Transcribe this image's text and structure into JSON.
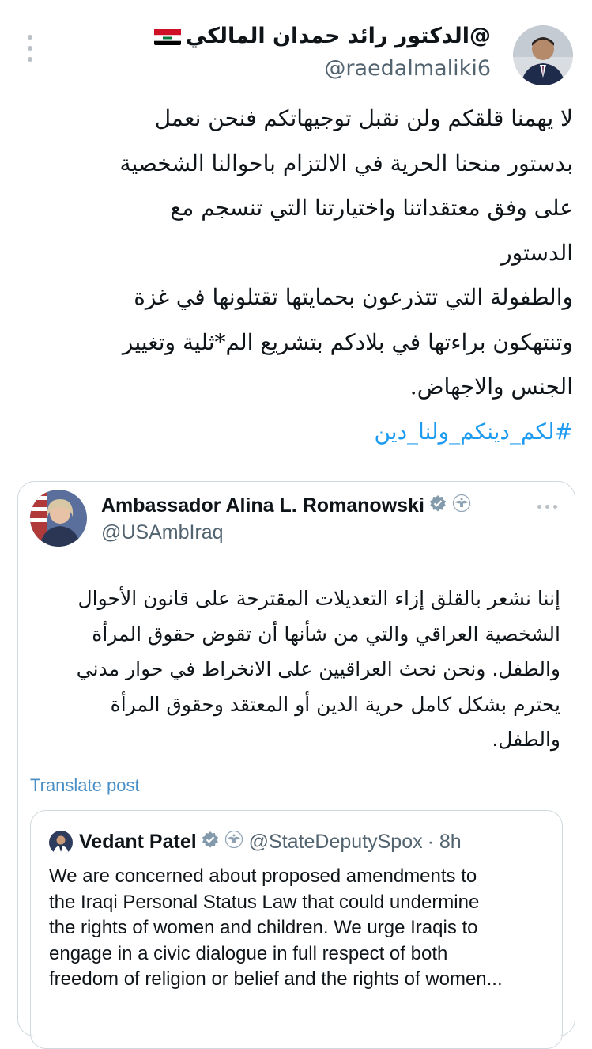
{
  "main_post": {
    "display_name": "@الدكتور رائد حمدان المالكي",
    "handle": "@raedalmaliki6",
    "lines": [
      "لا يهمنا قلقكم ولن نقبل توجيهاتكم فنحن نعمل",
      "بدستور منحنا الحرية في الالتزام باحوالنا الشخصية",
      "على وفق معتقداتنا واختيارتنا التي تنسجم مع",
      "الدستور",
      "والطفولة التي تتذرعون بحمايتها تقتلونها في غزة",
      "وتنتهكون براءتها في بلادكم بتشريع الم*ثلية وتغيير",
      "الجنس والاجهاض."
    ],
    "hashtag": "#لكم_دينكم_ولنا_دين",
    "flag_icon": "iraq-flag-icon"
  },
  "quoted_post": {
    "display_name": "Ambassador Alina L. Romanowski",
    "handle": "@USAmbIraq",
    "lines": [
      "إننا نشعر بالقلق إزاء التعديلات المقترحة على قانون الأحوال",
      "الشخصية العراقي والتي من شأنها أن تقوض حقوق المرأة",
      "والطفل. ونحن نحث العراقيين على الانخراط في حوار مدني",
      "يحترم بشكل كامل حرية الدين أو المعتقد وحقوق المرأة",
      "والطفل."
    ],
    "translate_label": "Translate post"
  },
  "nested_post": {
    "display_name": "Vedant Patel",
    "handle": "@StateDeputySpox",
    "time": "· 8h",
    "lines": [
      "We are concerned about proposed amendments to",
      "the Iraqi Personal Status Law that could undermine",
      "the rights of women and children. We urge Iraqis to",
      "engage in a civic dialogue in full respect of both",
      "freedom of religion or belief and the rights of women..."
    ]
  },
  "colors": {
    "accent_link": "#1d9bf0",
    "translate": "#4b8fc7",
    "secondary_text": "#536471",
    "border": "#cfd9de",
    "gov_badge_gray": "#829aab"
  }
}
